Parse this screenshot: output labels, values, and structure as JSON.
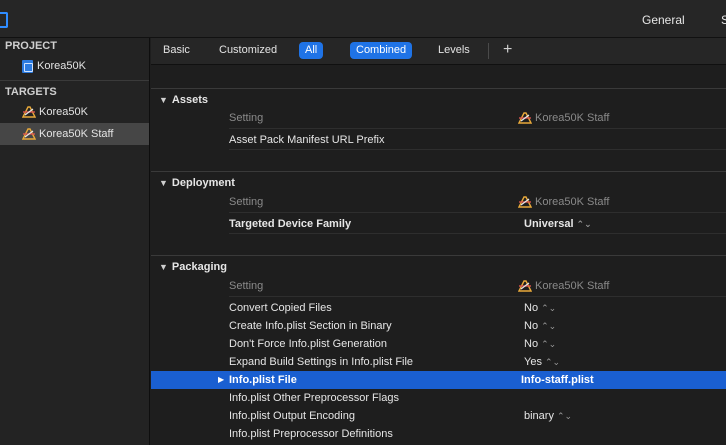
{
  "topbar": {
    "tabs": [
      "General",
      "S"
    ]
  },
  "sidebar": {
    "project_header": "PROJECT",
    "project_item": "Korea50K",
    "targets_header": "TARGETS",
    "targets": [
      {
        "label": "Korea50K",
        "selected": false
      },
      {
        "label": "Korea50K Staff",
        "selected": true
      }
    ]
  },
  "filterbar": {
    "basic": "Basic",
    "customized": "Customized",
    "all": "All",
    "combined": "Combined",
    "levels": "Levels",
    "add": "+"
  },
  "sections": {
    "assets": {
      "title": "Assets",
      "col_setting": "Setting",
      "col_target": "Korea50K Staff",
      "rows": [
        {
          "name": "Asset Pack Manifest URL Prefix",
          "value": ""
        }
      ]
    },
    "deployment": {
      "title": "Deployment",
      "col_setting": "Setting",
      "col_target": "Korea50K Staff",
      "rows": [
        {
          "name": "Targeted Device Family",
          "value": "Universal"
        }
      ]
    },
    "packaging": {
      "title": "Packaging",
      "col_setting": "Setting",
      "col_target": "Korea50K Staff",
      "rows": [
        {
          "name": "Convert Copied Files",
          "value": "No"
        },
        {
          "name": "Create Info.plist Section in Binary",
          "value": "No"
        },
        {
          "name": "Don't Force Info.plist Generation",
          "value": "No"
        },
        {
          "name": "Expand Build Settings in Info.plist File",
          "value": "Yes"
        },
        {
          "name": "Info.plist File",
          "value": "Info-staff.plist"
        },
        {
          "name": "Info.plist Other Preprocessor Flags",
          "value": ""
        },
        {
          "name": "Info.plist Output Encoding",
          "value": "binary"
        },
        {
          "name": "Info.plist Preprocessor Definitions",
          "value": ""
        }
      ]
    }
  },
  "icons": {
    "target": "xcode-target-icon",
    "project": "xcode-project-icon",
    "stepper": "⌃⌄"
  },
  "colors": {
    "accent": "#1f73e6",
    "selection": "#1a5fd1"
  }
}
